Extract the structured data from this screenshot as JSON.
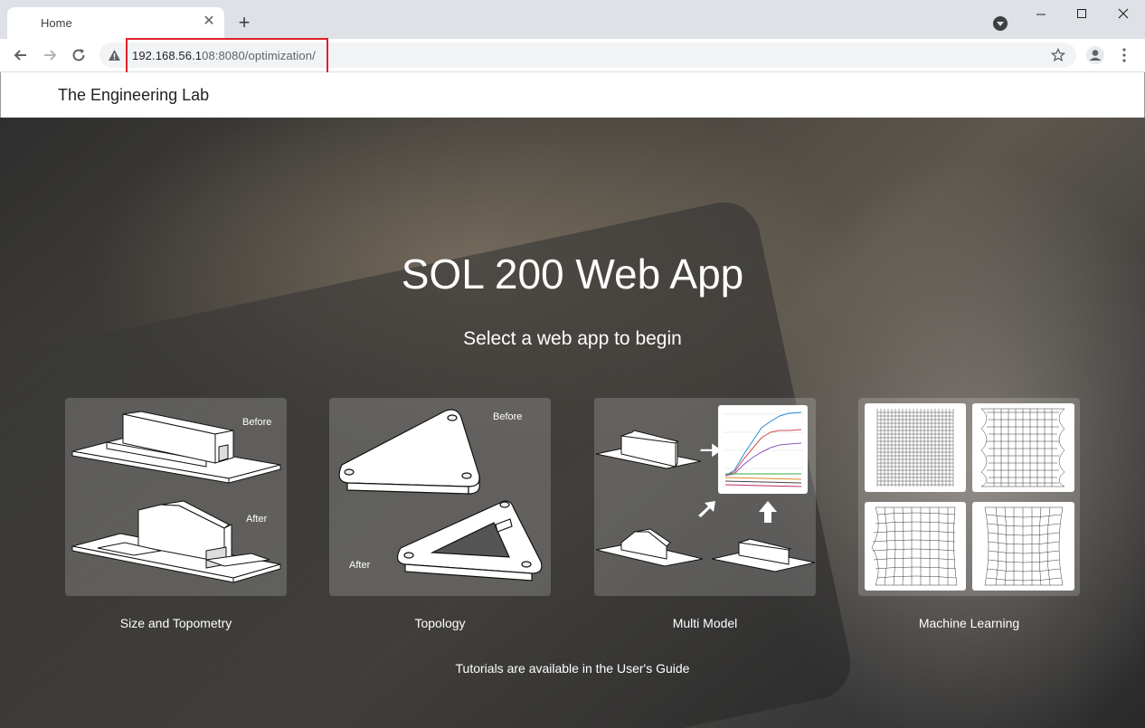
{
  "browser": {
    "tab_title": "Home",
    "url_host": "192.168.56.1",
    "url_rest": "08:8080/optimization/"
  },
  "site": {
    "brand": "The Engineering Lab"
  },
  "hero": {
    "title": "SOL 200 Web App",
    "subtitle": "Select a web app to begin",
    "footer_note": "Tutorials are available in the User's Guide"
  },
  "cards": [
    {
      "label": "Size and Topometry",
      "before": "Before",
      "after": "After"
    },
    {
      "label": "Topology",
      "before": "Before",
      "after": "After"
    },
    {
      "label": "Multi Model"
    },
    {
      "label": "Machine Learning"
    }
  ]
}
